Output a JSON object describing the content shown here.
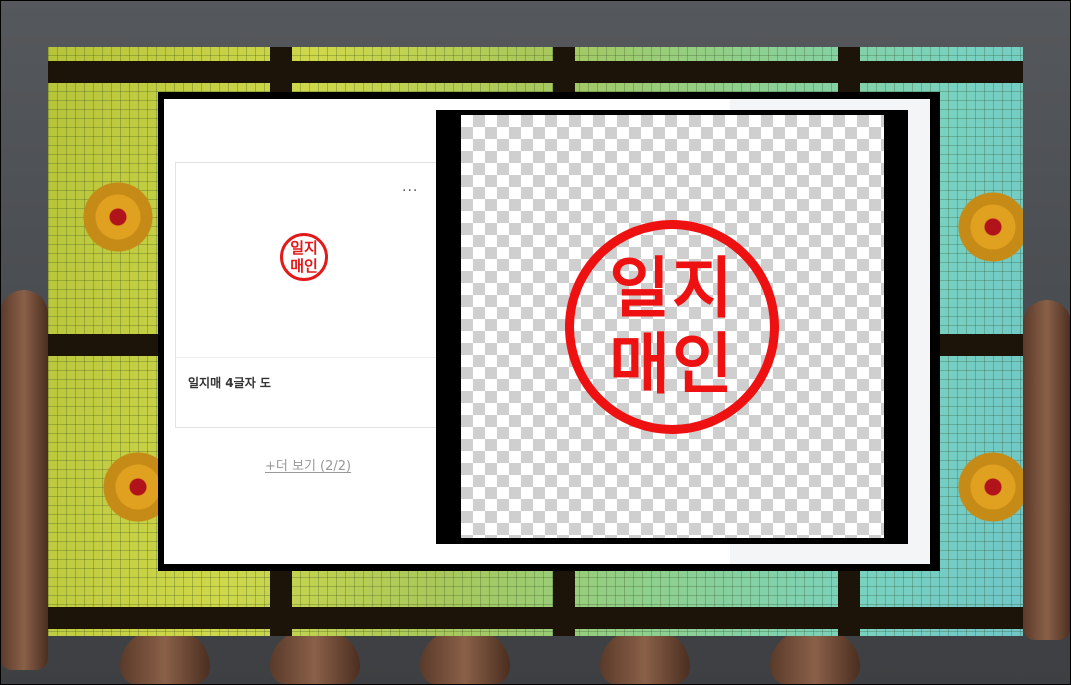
{
  "card": {
    "title": "일지매 4글자 도",
    "more_icon": "···",
    "stamp_line1": "일지",
    "stamp_line2": "매인"
  },
  "more_link": "+더 보기 (2/2)",
  "preview": {
    "stamp_line1": "일지",
    "stamp_line2": "매인"
  },
  "colors": {
    "stamp_red": "#ee1111",
    "frame": "#000000",
    "glass_green": "#cfd84a",
    "glass_teal": "#6fc6c8"
  },
  "icons": [
    "more-options-icon",
    "seal-stamp-image"
  ]
}
